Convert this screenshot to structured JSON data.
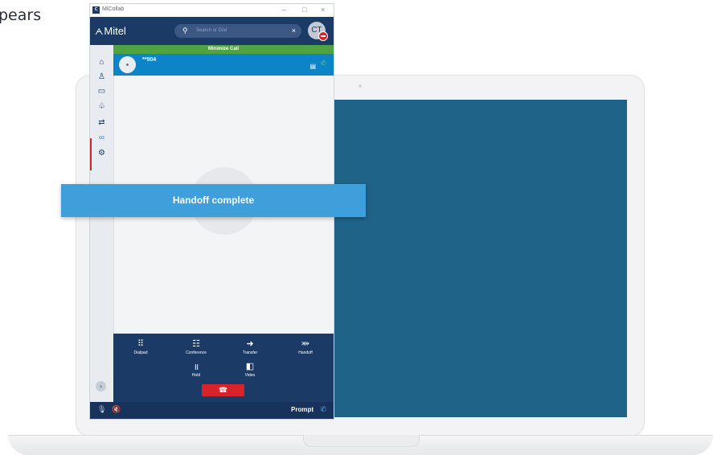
{
  "background": {
    "text": "pears"
  },
  "window": {
    "title": "MiCollab",
    "logo": "C",
    "controls": {
      "minimize": "–",
      "maximize": "□",
      "close": "×"
    }
  },
  "header": {
    "brand_mark": "ᗅ",
    "brand": "Mitel",
    "search_placeholder": "Search or Dial",
    "search_clear": "×",
    "avatar_initials": "CT"
  },
  "sidebar": {
    "items": [
      {
        "icon": "home-icon",
        "glyph": "⌂"
      },
      {
        "icon": "contacts-icon",
        "glyph": "♙"
      },
      {
        "icon": "chat-icon",
        "glyph": "▭"
      },
      {
        "icon": "team-icon",
        "glyph": "♧"
      },
      {
        "icon": "call-history-icon",
        "glyph": "⇄"
      },
      {
        "icon": "voicemail-icon",
        "glyph": "∞"
      },
      {
        "icon": "settings-icon",
        "glyph": "⚙"
      }
    ],
    "expand_glyph": "›"
  },
  "call": {
    "minimize_label": "Minimize Call",
    "number": "**904",
    "lock_glyph": "🔒",
    "phone_glyph": "✆"
  },
  "controls": {
    "dialpad": {
      "label": "Dialpad",
      "glyph": "⠿"
    },
    "conference": {
      "label": "Conference",
      "glyph": "☷"
    },
    "transfer": {
      "label": "Transfer",
      "glyph": "➜"
    },
    "handoff": {
      "label": "Handoff",
      "glyph": "⤘"
    },
    "hold": {
      "label": "Hold",
      "glyph": "॥"
    },
    "video": {
      "label": "Video",
      "glyph": "◧"
    },
    "end_glyph": "☎"
  },
  "statusbar": {
    "mic_glyph": "🎙",
    "speaker_glyph": "🔇",
    "prompt_label": "Prompt",
    "prompt_glyph": "✆"
  },
  "toast": {
    "message": "Handoff complete"
  },
  "colors": {
    "header": "#1b3a66",
    "green": "#4fa442",
    "call_blue": "#0e84c8",
    "toast": "#3e9fdb",
    "end_red": "#d8232a",
    "screen": "#1f6389"
  }
}
